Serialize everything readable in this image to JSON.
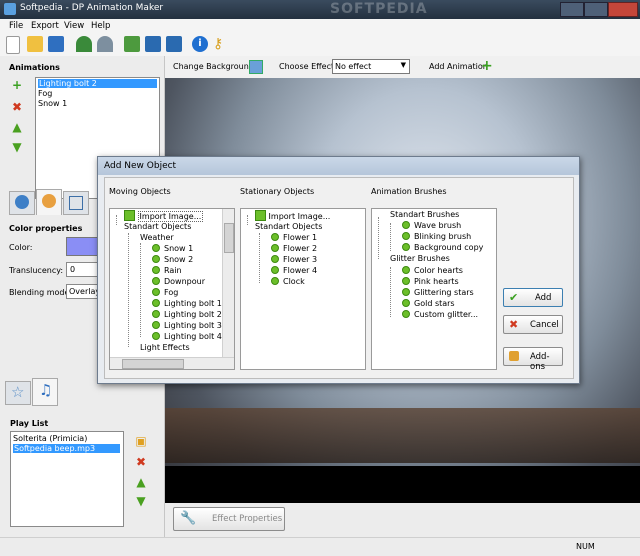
{
  "window": {
    "title": "Softpedia - DP Animation Maker",
    "watermark": "SOFTPEDIA"
  },
  "menu": [
    "File",
    "Export",
    "View",
    "Help"
  ],
  "toolbar_icons": [
    "new-icon",
    "open-icon",
    "save-icon",
    "undo-icon",
    "redo-icon",
    "export-icon",
    "export-image-icon",
    "export-video-icon",
    "info-icon",
    "key-icon"
  ],
  "animations": {
    "label": "Animations",
    "items": [
      "Lighting bolt 2",
      "Fog",
      "Snow 1"
    ],
    "selected": 0
  },
  "color_properties": {
    "label": "Color properties",
    "color_label": "Color:",
    "color_value": "#8a8ef5",
    "translucency_label": "Translucency:",
    "translucency_value": "0",
    "blending_label": "Blending mode:",
    "blending_value": "Overlay"
  },
  "playlist": {
    "label": "Play List",
    "items": [
      "Solterita (Primicia)",
      "Softpedia beep.mp3"
    ],
    "selected": 1
  },
  "effect_bar": {
    "change_background": "Change Background",
    "choose_effect": "Choose Effect:",
    "effect_value": "No effect",
    "add_animation": "Add Animation"
  },
  "effect_properties": "Effect Properties",
  "dialog": {
    "title": "Add New Object",
    "moving_label": "Moving Objects",
    "stationary_label": "Stationary Objects",
    "brushes_label": "Animation Brushes",
    "moving": {
      "import": "Import Image...",
      "std": "Standart Objects",
      "weather": "Weather",
      "weather_items": [
        "Snow 1",
        "Snow 2",
        "Rain",
        "Downpour",
        "Fog",
        "Lighting bolt 1",
        "Lighting bolt 2",
        "Lighting bolt 3",
        "Lighting bolt 4"
      ],
      "light": "Light Effects"
    },
    "stationary": {
      "import": "Import Image...",
      "std": "Standart Objects",
      "items": [
        "Flower 1",
        "Flower 2",
        "Flower 3",
        "Flower 4",
        "Clock"
      ]
    },
    "brushes": {
      "std": "Standart Brushes",
      "std_items": [
        "Wave brush",
        "Blinking brush",
        "Background copy"
      ],
      "glitter": "Glitter Brushes",
      "glitter_items": [
        "Color hearts",
        "Pink hearts",
        "Glittering stars",
        "Gold stars",
        "Custom glitter..."
      ]
    },
    "buttons": {
      "add": "Add",
      "cancel": "Cancel",
      "addons": "Add-ons"
    }
  },
  "status": {
    "num": "NUM"
  }
}
